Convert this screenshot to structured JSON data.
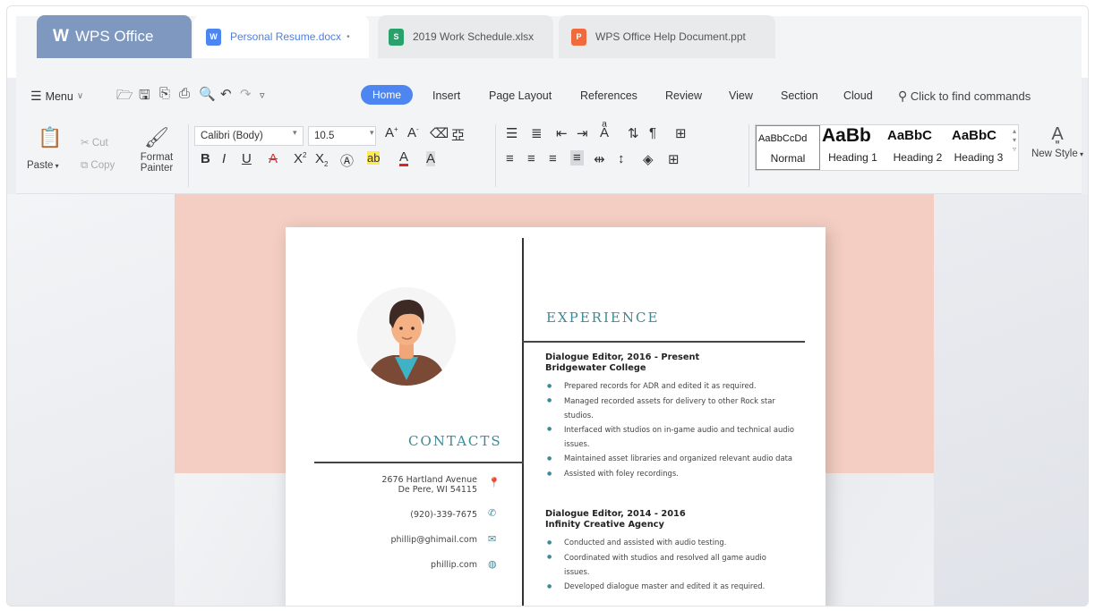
{
  "tabs": [
    {
      "label": "WPS Office",
      "icon": "wps-logo-icon"
    },
    {
      "label": "Personal Resume.docx",
      "icon": "word-doc-icon",
      "icon_letter": "W"
    },
    {
      "label": "2019 Work Schedule.xlsx",
      "icon": "spreadsheet-icon",
      "icon_letter": "S"
    },
    {
      "label": "WPS Office Help Document.ppt",
      "icon": "presentation-icon",
      "icon_letter": "P"
    }
  ],
  "menu": {
    "menu_label": "Menu",
    "items": [
      "Home",
      "Insert",
      "Page Layout",
      "References",
      "Review",
      "View",
      "Section",
      "Cloud"
    ],
    "find_commands": "Click to find commands"
  },
  "toolbar": {
    "paste": "Paste",
    "cut": "Cut",
    "copy": "Copy",
    "format_painter_1": "Format",
    "format_painter_2": "Painter",
    "font_name": "Calibri (Body)",
    "font_size": "10.5",
    "new_style": "New Style"
  },
  "styles": [
    {
      "preview": "AaBbCcDd",
      "name": "Normal"
    },
    {
      "preview": "AaBb",
      "name": "Heading 1"
    },
    {
      "preview": "AaBbC",
      "name": "Heading 2"
    },
    {
      "preview": "AaBbC",
      "name": "Heading 3"
    }
  ],
  "resume": {
    "experience_title": "EXPERIENCE",
    "contacts_title": "CONTACTS",
    "contacts": {
      "address_1": "2676 Hartland Avenue",
      "address_2": "De Pere, WI 54115",
      "phone": "(920)-339-7675",
      "email": "phillip@ghimail.com",
      "website": "phillip.com"
    },
    "jobs": [
      {
        "title": "Dialogue Editor, 2016 - Present",
        "org": "Bridgewater College",
        "bullets": [
          "Prepared records for ADR and edited it as required.",
          "Managed recorded assets for delivery to other Rock star studios.",
          "Interfaced with studios on in-game audio and technical audio issues.",
          "Maintained asset libraries and organized relevant audio data",
          "Assisted with foley recordings."
        ]
      },
      {
        "title": "Dialogue Editor, 2014 - 2016",
        "org": "Infinity Creative Agency",
        "bullets": [
          "Conducted and assisted with audio testing.",
          "Coordinated with studios and resolved all game audio issues.",
          "Developed dialogue master and edited it as required."
        ]
      }
    ]
  },
  "colors": {
    "accent": "#4d86f0",
    "home_tab": "#7f98bf",
    "resume_teal": "#3c8a97",
    "header_pink": "#f4cec3"
  }
}
